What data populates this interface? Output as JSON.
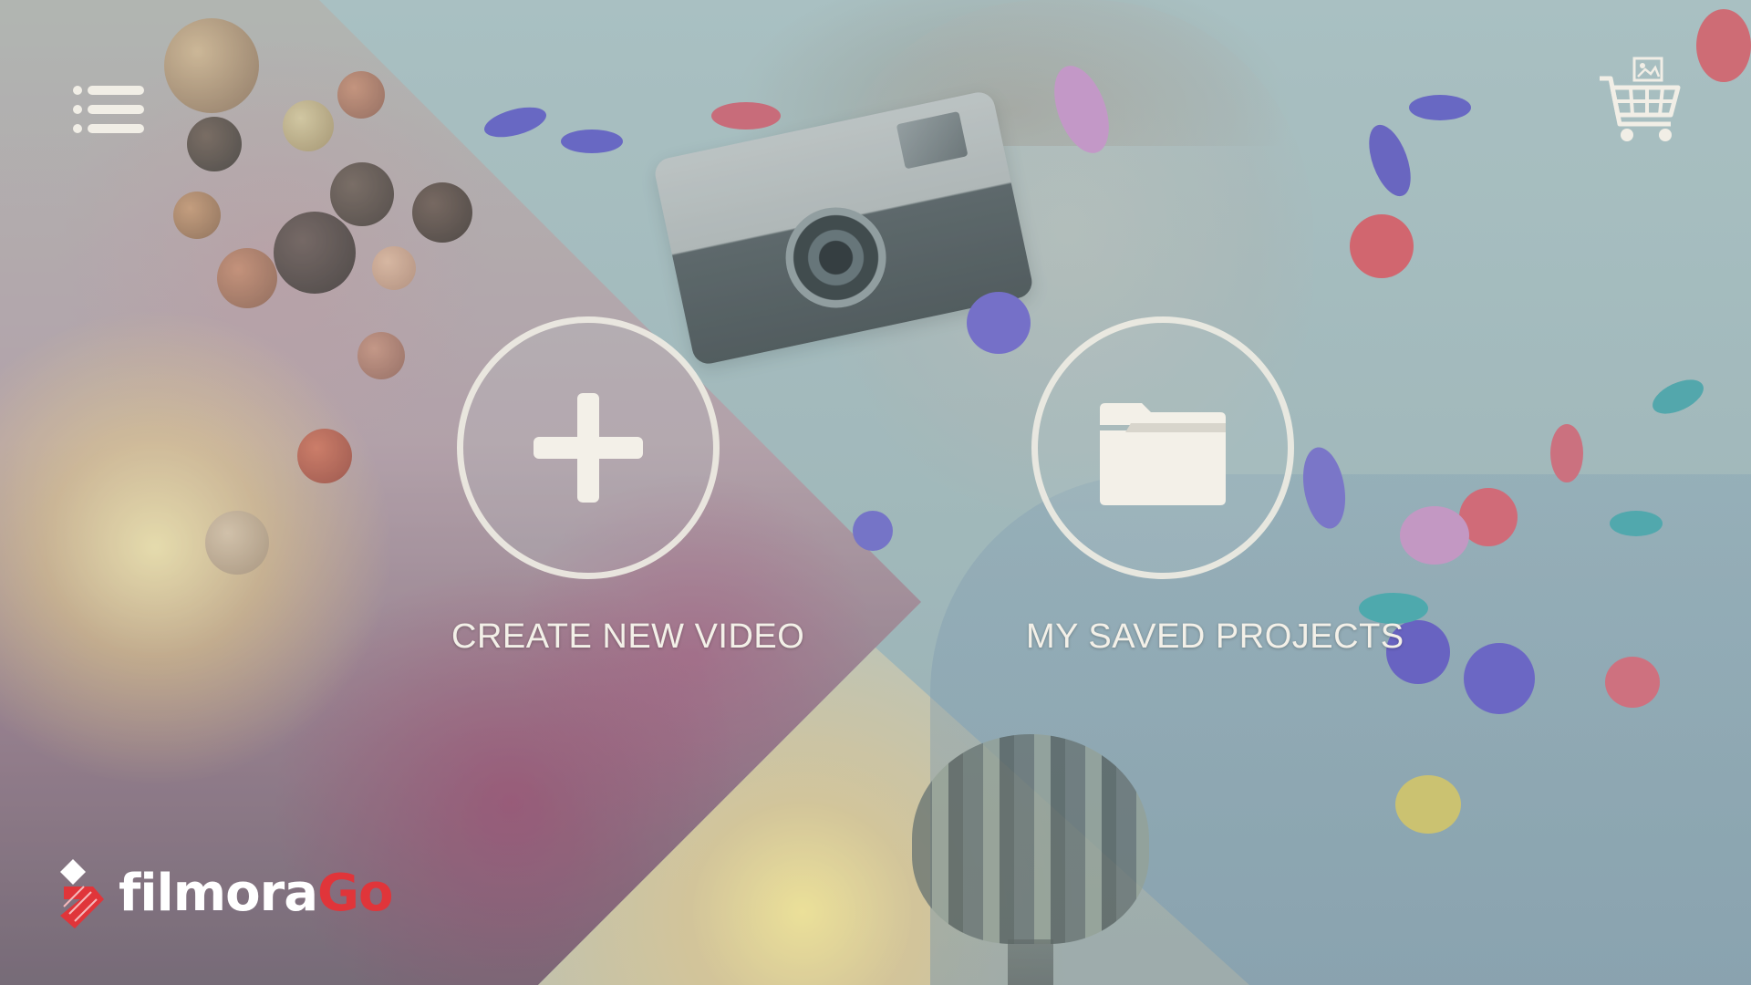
{
  "app": {
    "name": "FilmoraGo"
  },
  "header": {
    "menu_icon": "menu-list-icon",
    "store_icon": "shopping-cart-icon"
  },
  "actions": [
    {
      "label": "CREATE NEW VIDEO",
      "icon": "plus-icon"
    },
    {
      "label": "MY SAVED PROJECTS",
      "icon": "folder-icon"
    }
  ],
  "logo": {
    "text_part1": "filmora",
    "text_part2": "Go",
    "colors": {
      "primary": "#ffffff",
      "accent": "#e0353a"
    }
  },
  "colors": {
    "ui_foreground": "#f1eee6",
    "background_tint": "#a9c0c1"
  }
}
